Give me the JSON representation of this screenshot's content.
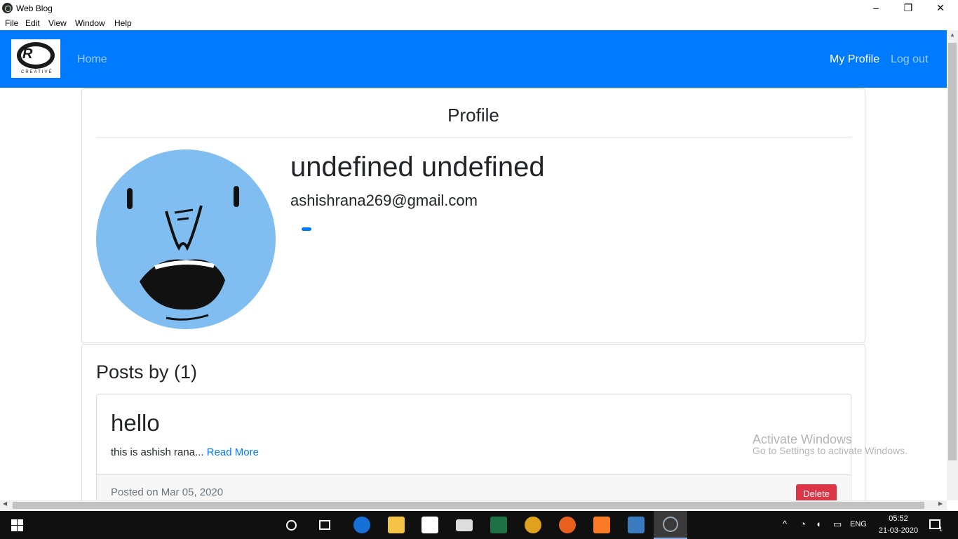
{
  "window": {
    "title": "Web Blog",
    "minimize": "–",
    "restore": "❐",
    "close": "✕"
  },
  "menu": {
    "items": [
      "File",
      "Edit",
      "View",
      "Window",
      "Help"
    ]
  },
  "navbar": {
    "brand_icon": "ar-creative-logo",
    "brand_text": "R",
    "brand_sub": "CREATIVE",
    "home": "Home",
    "my_profile": "My Profile",
    "logout": "Log out",
    "color": "#007bff"
  },
  "profile": {
    "heading": "Profile",
    "full_name": "undefined undefined",
    "email": "ashishrana269@gmail.com",
    "avatar_icon": "cartoon-face-avatar"
  },
  "posts": {
    "heading": "Posts by (1)",
    "items": [
      {
        "title": "hello",
        "excerpt": "this is ashish rana...",
        "read_more": "Read More",
        "posted_on": "Posted on Mar 05, 2020",
        "delete_label": "Delete"
      }
    ]
  },
  "watermark": {
    "line1": "Activate Windows",
    "line2": "Go to Settings to activate Windows."
  },
  "taskbar": {
    "time": "05:52",
    "date": "21-03-2020",
    "language": "ENG",
    "notification_count": "1",
    "icons": [
      "windows-start-icon",
      "cortana-icon",
      "task-view-icon",
      "edge-icon",
      "file-explorer-icon",
      "store-icon",
      "mail-icon",
      "excel-icon",
      "chrome-icon",
      "firefox-icon",
      "xampp-icon",
      "virtualbox-icon",
      "electron-icon"
    ]
  },
  "colors": {
    "primary": "#007bff",
    "danger": "#dc3545",
    "taskbar": "#101010"
  }
}
